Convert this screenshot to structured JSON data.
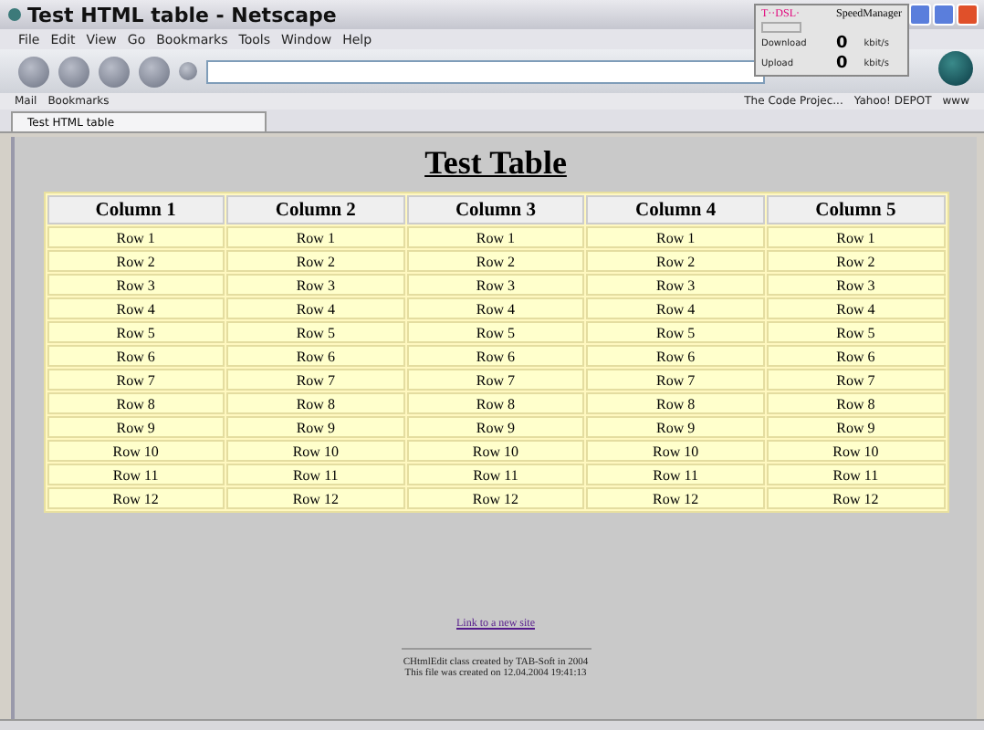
{
  "window": {
    "title": "Test HTML table - Netscape"
  },
  "menu": [
    "File",
    "Edit",
    "View",
    "Go",
    "Bookmarks",
    "Tools",
    "Window",
    "Help"
  ],
  "personal_bar": [
    "Mail",
    "Bookmarks"
  ],
  "bookmarks": [
    "The Code Projec...",
    "Yahoo! DEPOT",
    "www"
  ],
  "speed_manager": {
    "brand": "T··DSL·",
    "title": "SpeedManager",
    "download_label": "Download",
    "download_value": "0",
    "download_unit": "kbit/s",
    "upload_label": "Upload",
    "upload_value": "0",
    "upload_unit": "kbit/s"
  },
  "tabs": [
    {
      "label": "Test HTML table",
      "selected": true
    }
  ],
  "page": {
    "heading": "Test Table",
    "table": {
      "columns": [
        "Column 1",
        "Column 2",
        "Column 3",
        "Column 4",
        "Column 5"
      ],
      "rows": [
        [
          "Row 1",
          "Row 1",
          "Row 1",
          "Row 1",
          "Row 1"
        ],
        [
          "Row 2",
          "Row 2",
          "Row 2",
          "Row 2",
          "Row 2"
        ],
        [
          "Row 3",
          "Row 3",
          "Row 3",
          "Row 3",
          "Row 3"
        ],
        [
          "Row 4",
          "Row 4",
          "Row 4",
          "Row 4",
          "Row 4"
        ],
        [
          "Row 5",
          "Row 5",
          "Row 5",
          "Row 5",
          "Row 5"
        ],
        [
          "Row 6",
          "Row 6",
          "Row 6",
          "Row 6",
          "Row 6"
        ],
        [
          "Row 7",
          "Row 7",
          "Row 7",
          "Row 7",
          "Row 7"
        ],
        [
          "Row 8",
          "Row 8",
          "Row 8",
          "Row 8",
          "Row 8"
        ],
        [
          "Row 9",
          "Row 9",
          "Row 9",
          "Row 9",
          "Row 9"
        ],
        [
          "Row 10",
          "Row 10",
          "Row 10",
          "Row 10",
          "Row 10"
        ],
        [
          "Row 11",
          "Row 11",
          "Row 11",
          "Row 11",
          "Row 11"
        ],
        [
          "Row 12",
          "Row 12",
          "Row 12",
          "Row 12",
          "Row 12"
        ]
      ]
    },
    "link": "Link to a new site",
    "footer": [
      "CHtmlEdit class created by TAB-Soft in 2004",
      "This file was created on 12.04.2004 19:41:13"
    ]
  }
}
